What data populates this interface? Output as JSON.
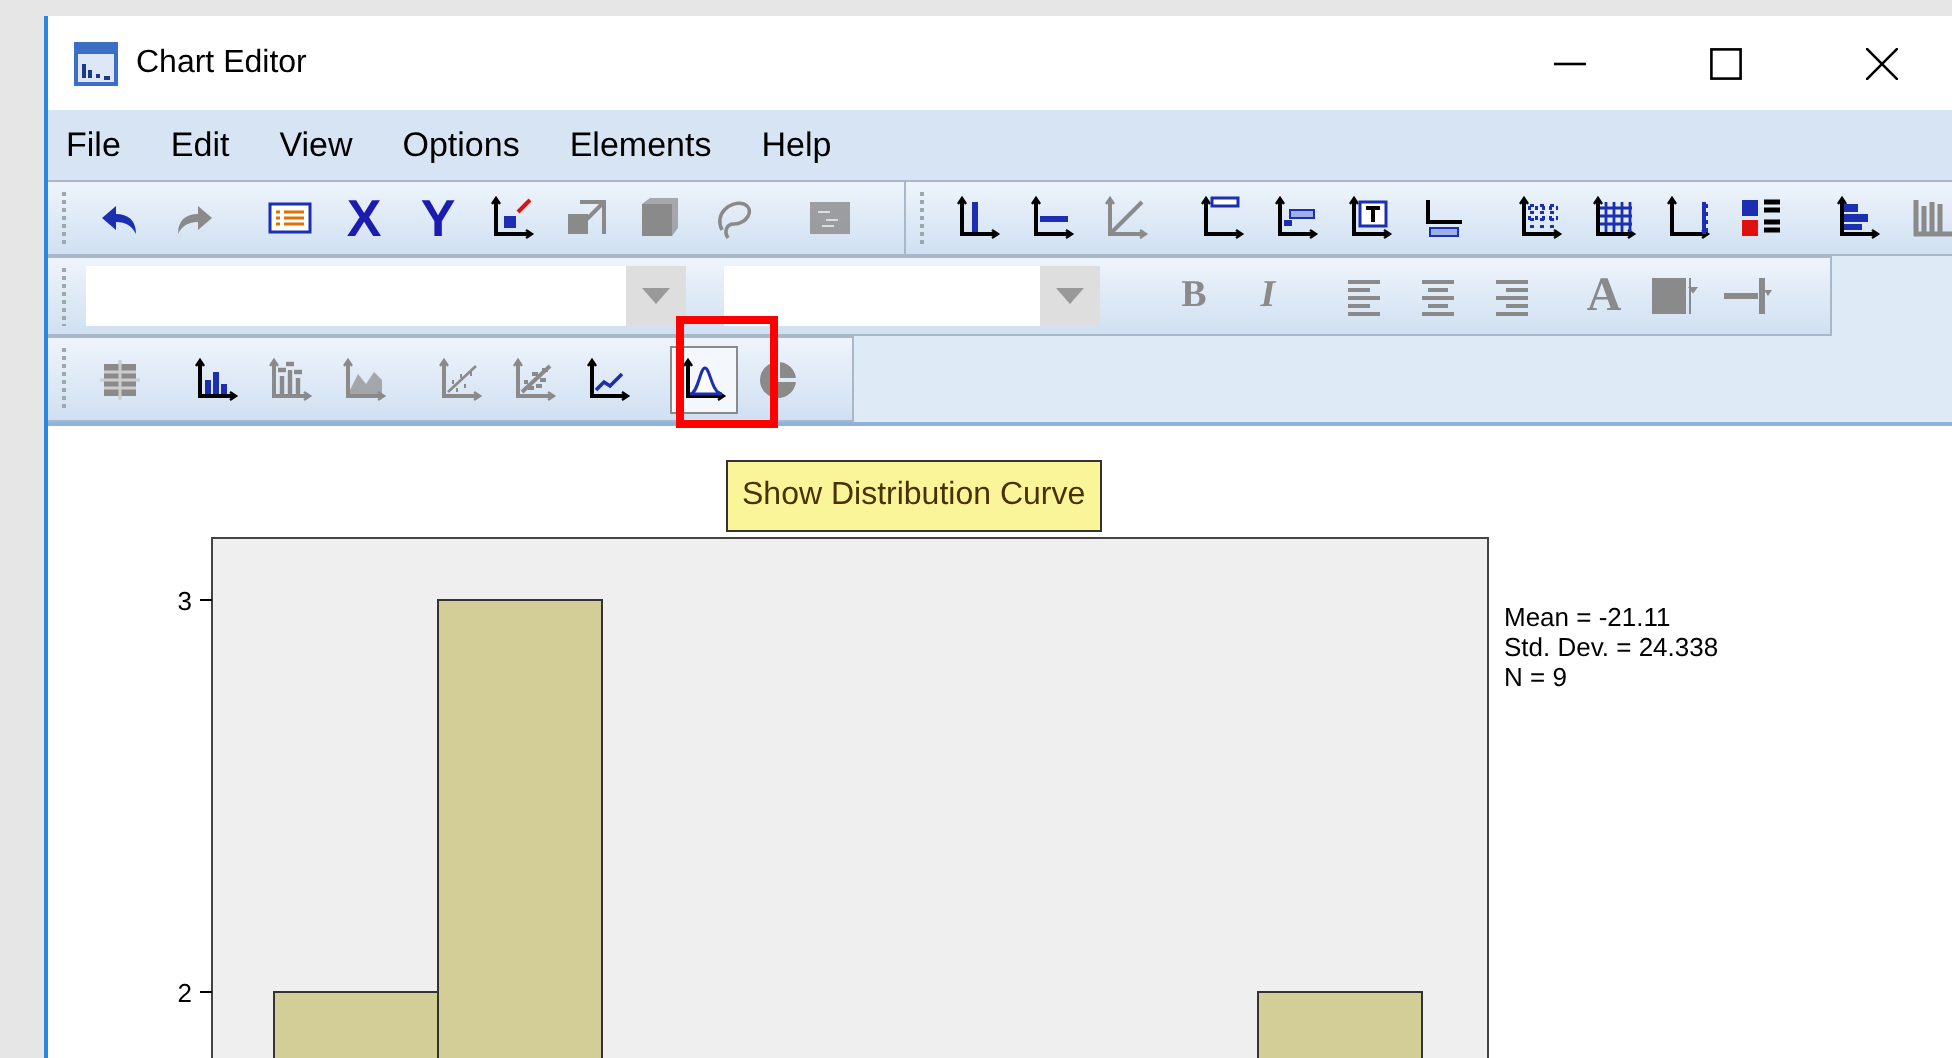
{
  "window": {
    "title": "Chart Editor"
  },
  "menu": [
    {
      "label": "File"
    },
    {
      "label": "Edit"
    },
    {
      "label": "View"
    },
    {
      "label": "Options"
    },
    {
      "label": "Elements"
    },
    {
      "label": "Help"
    }
  ],
  "toolbar_rows": [
    [
      {
        "groups": [
          [
            {
              "kind": "icon",
              "disabled": false
            },
            {
              "kind": "icon",
              "disabled": true
            }
          ],
          [
            {
              "kind": "icon",
              "disabled": false
            },
            {
              "kind": "letter",
              "label": "X",
              "disabled": false
            },
            {
              "kind": "letter",
              "label": "Y",
              "disabled": false
            },
            {
              "kind": "icon",
              "disabled": false
            },
            {
              "kind": "icon",
              "disabled": true
            },
            {
              "kind": "icon",
              "disabled": true
            },
            {
              "kind": "icon",
              "disabled": true
            }
          ],
          [
            {
              "kind": "icon",
              "disabled": true
            }
          ]
        ]
      },
      {
        "groups": [
          [
            {
              "kind": "icon",
              "disabled": false
            },
            {
              "kind": "icon",
              "disabled": false
            },
            {
              "kind": "icon",
              "disabled": true
            }
          ],
          [
            {
              "kind": "icon",
              "disabled": false
            },
            {
              "kind": "icon",
              "disabled": false
            },
            {
              "kind": "icon",
              "disabled": false
            },
            {
              "kind": "icon",
              "disabled": false
            }
          ],
          [
            {
              "kind": "icon",
              "disabled": false
            },
            {
              "kind": "icon",
              "disabled": false
            },
            {
              "kind": "icon",
              "disabled": false
            },
            {
              "kind": "icon",
              "disabled": false
            }
          ],
          [
            {
              "kind": "icon",
              "disabled": false
            },
            {
              "kind": "icon",
              "disabled": true
            }
          ]
        ]
      }
    ],
    [
      {
        "groups": [
          [
            {
              "kind": "combo",
              "disabled": true
            },
            {
              "kind": "combo",
              "disabled": true
            }
          ],
          [
            {
              "kind": "letter",
              "label": "B",
              "disabled": true
            },
            {
              "kind": "letter",
              "label": "I",
              "disabled": true
            }
          ],
          [
            {
              "kind": "icon",
              "disabled": true
            },
            {
              "kind": "icon",
              "disabled": true
            },
            {
              "kind": "icon",
              "disabled": true
            }
          ],
          [
            {
              "kind": "letter",
              "label": "A",
              "disabled": true
            },
            {
              "kind": "icon",
              "disabled": true
            },
            {
              "kind": "icon",
              "disabled": true
            }
          ]
        ]
      }
    ],
    [
      {
        "groups": [
          [
            {
              "kind": "icon",
              "disabled": true,
              "pressed": false
            }
          ],
          [
            {
              "kind": "icon",
              "disabled": false,
              "pressed": false
            },
            {
              "kind": "icon",
              "disabled": true,
              "pressed": false
            },
            {
              "kind": "icon",
              "disabled": true,
              "pressed": false
            }
          ],
          [
            {
              "kind": "icon",
              "disabled": true,
              "pressed": false
            },
            {
              "kind": "icon",
              "disabled": true,
              "pressed": false
            },
            {
              "kind": "icon",
              "disabled": false,
              "pressed": false
            }
          ],
          [
            {
              "kind": "icon",
              "disabled": false,
              "pressed": true
            },
            {
              "kind": "icon",
              "disabled": true,
              "pressed": false
            }
          ]
        ]
      }
    ]
  ],
  "tooltip": "Show Distribution Curve",
  "highlight": {
    "shown": true
  },
  "statistics": [
    "Mean = -21.11",
    "Std. Dev. = 24.338",
    "N = 9"
  ],
  "histogram": {
    "y_tick_labels": [
      "3",
      "2"
    ]
  }
}
